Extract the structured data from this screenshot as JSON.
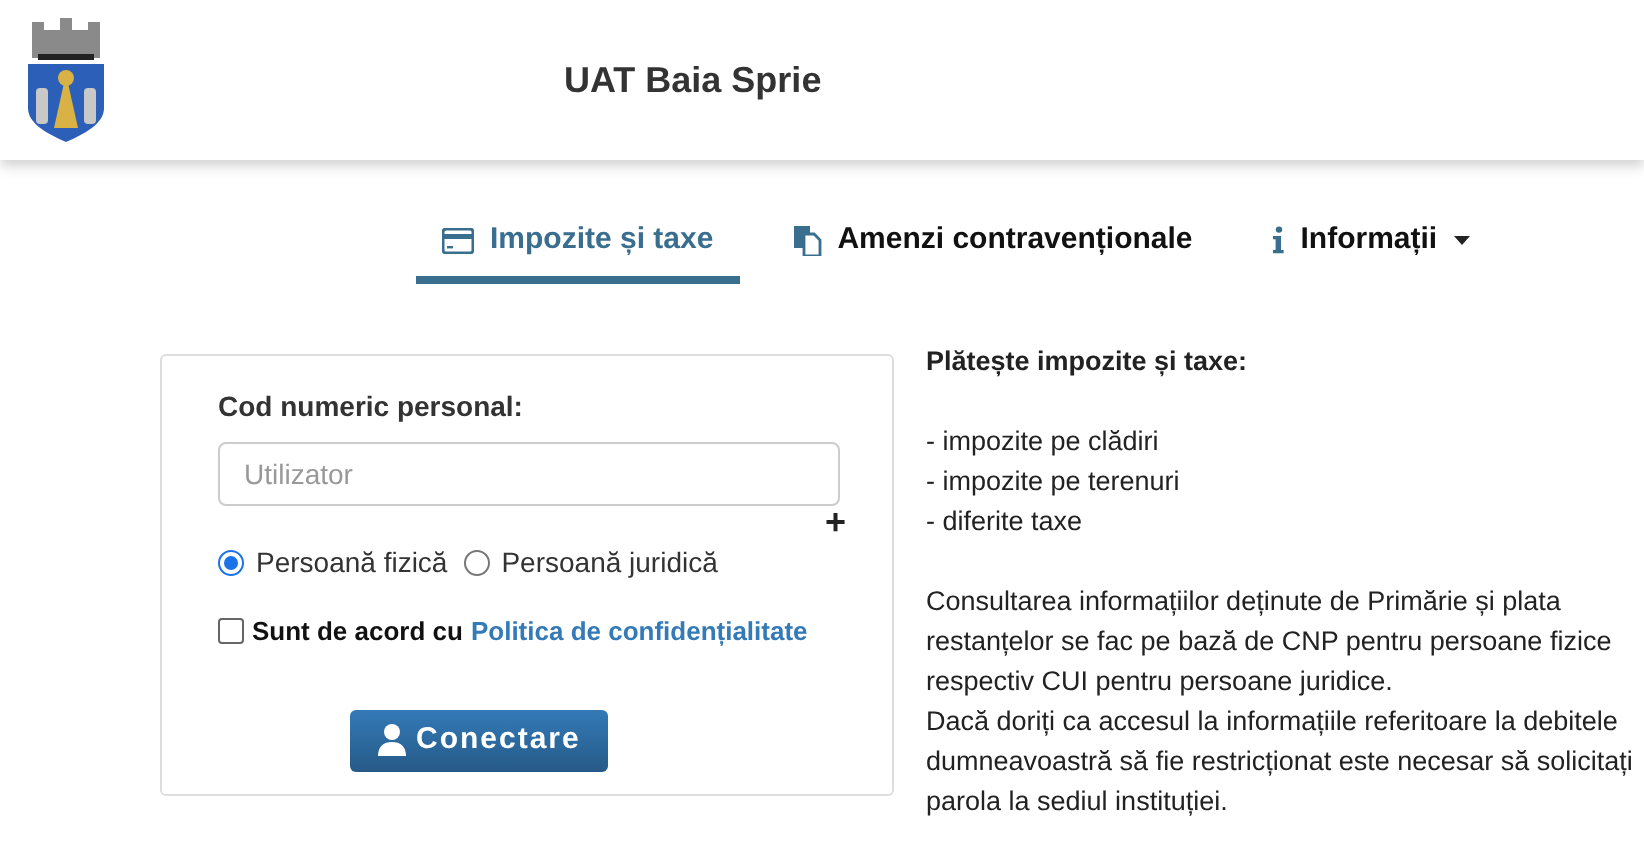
{
  "header": {
    "title": "UAT Baia Sprie"
  },
  "tabs": [
    {
      "kind": "card",
      "label": "Impozite și taxe",
      "selected": true
    },
    {
      "kind": "copy",
      "label": "Amenzi contravenționale",
      "selected": false
    },
    {
      "kind": "info",
      "label": "Informații",
      "selected": false,
      "dropdown": true
    }
  ],
  "form": {
    "label": "Cod numeric personal:",
    "placeholder": "Utilizator",
    "add": "+",
    "person_types": [
      {
        "label": "Persoană fizică",
        "selected": true
      },
      {
        "label": "Persoană juridică",
        "selected": false
      }
    ],
    "agree": {
      "text": "Sunt de acord cu",
      "link": "Politica de confidențialitate",
      "checked": false
    },
    "button": "Conectare"
  },
  "info": {
    "heading": "Plătește impozite și taxe:",
    "items": [
      "- impozite pe clădiri",
      "- impozite pe terenuri",
      "- diferite taxe"
    ],
    "paragraphs": [
      "Consultarea informațiilor deținute de Primărie și plata restanțelor se fac pe bază de CNP pentru persoane fizice respectiv CUI pentru persoane juridice.",
      "Dacă doriți ca accesul la informațiile referitoare la debitele dumneavoastră să fie restricționat este necesar să solicitați parola la sediul instituției."
    ]
  }
}
